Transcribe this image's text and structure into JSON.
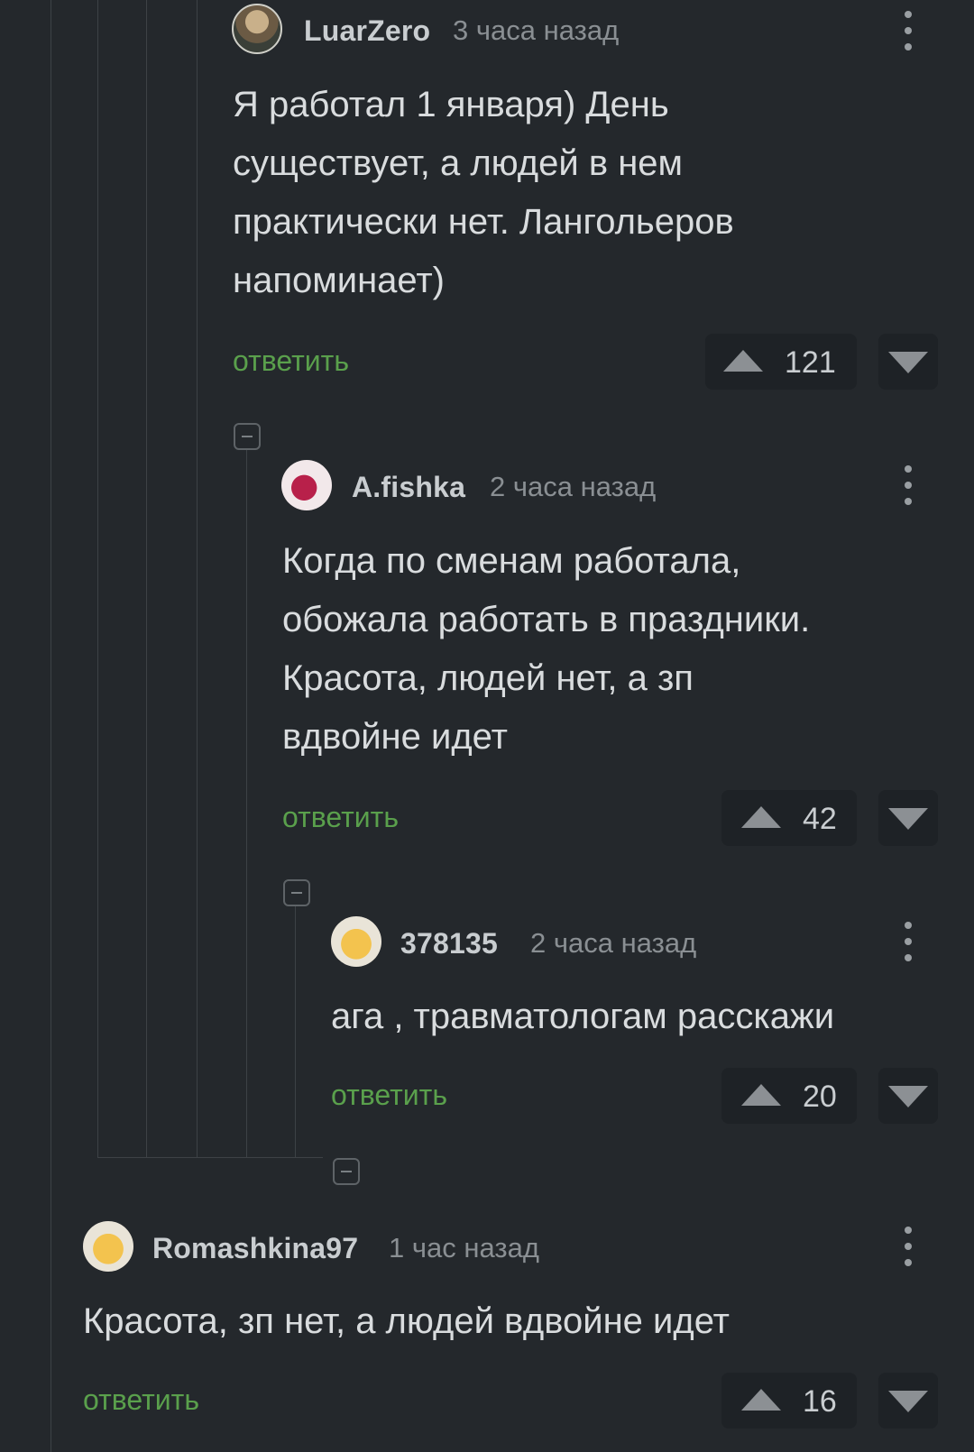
{
  "comments": [
    {
      "author": "LuarZero",
      "time": "3 часа назад",
      "lines": [
        "Я работал 1 января) День",
        "существует, а людей в нем",
        "практически нет. Лангольеров",
        "напоминает)"
      ],
      "reply": "ответить",
      "rating": "121",
      "avatar_icon": "bearded-man-avatar-icon"
    },
    {
      "author": "A.fishka",
      "time": "2 часа назад",
      "lines": [
        "Когда по сменам работала,",
        "обожала работать в праздники.",
        "Красота, людей нет, а зп",
        "вдвойне идет"
      ],
      "reply": "ответить",
      "rating": "42",
      "avatar_icon": "heart-avatar-icon"
    },
    {
      "author": "378135",
      "time": "2 часа назад",
      "lines": [
        "ага , травматологам расскажи"
      ],
      "reply": "ответить",
      "rating": "20",
      "avatar_icon": "sleepy-face-avatar-icon"
    },
    {
      "author": "Romashkina97",
      "time": "1 час назад",
      "lines": [
        "Красота, зп нет, а людей вдвойне идет"
      ],
      "reply": "ответить",
      "rating": "16",
      "avatar_icon": "sleepy-face-avatar-icon"
    }
  ],
  "colors": {
    "background": "#24282c",
    "reply_link": "#5aa04c",
    "thread_line": "#3d4246",
    "rating_box": "#1e2226"
  }
}
